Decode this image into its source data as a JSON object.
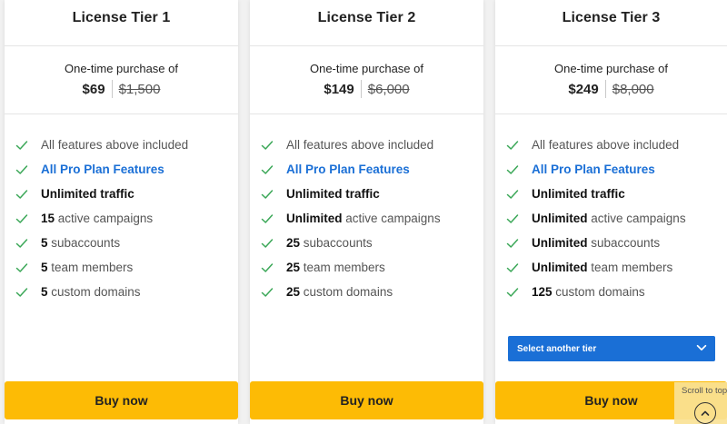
{
  "colors": {
    "accent": "#1a6fd6",
    "buy_button": "#fdbb05",
    "check": "#3aa757"
  },
  "tiers": [
    {
      "title": "License Tier 1",
      "price_caption": "One-time purchase of",
      "price_now": "$69",
      "price_old": "$1,500",
      "features": [
        {
          "strong": "",
          "text": "All features above included"
        },
        {
          "link": "All Pro Plan Features"
        },
        {
          "strong": "Unlimited traffic",
          "text": ""
        },
        {
          "strong": "15",
          "text": " active campaigns"
        },
        {
          "strong": "5",
          "text": " subaccounts"
        },
        {
          "strong": "5",
          "text": " team members"
        },
        {
          "strong": "5",
          "text": " custom domains"
        }
      ],
      "buy_label": "Buy now"
    },
    {
      "title": "License Tier 2",
      "price_caption": "One-time purchase of",
      "price_now": "$149",
      "price_old": "$6,000",
      "features": [
        {
          "strong": "",
          "text": "All features above included"
        },
        {
          "link": "All Pro Plan Features"
        },
        {
          "strong": "Unlimited traffic",
          "text": ""
        },
        {
          "strong": "Unlimited",
          "text": " active campaigns"
        },
        {
          "strong": "25",
          "text": " subaccounts"
        },
        {
          "strong": "25",
          "text": " team members"
        },
        {
          "strong": "25",
          "text": " custom domains"
        }
      ],
      "buy_label": "Buy now"
    },
    {
      "title": "License Tier 3",
      "price_caption": "One-time purchase of",
      "price_now": "$249",
      "price_old": "$8,000",
      "features": [
        {
          "strong": "",
          "text": "All features above included"
        },
        {
          "link": "All Pro Plan Features"
        },
        {
          "strong": "Unlimited traffic",
          "text": ""
        },
        {
          "strong": "Unlimited",
          "text": " active campaigns"
        },
        {
          "strong": "Unlimited",
          "text": " subaccounts"
        },
        {
          "strong": "Unlimited",
          "text": " team members"
        },
        {
          "strong": "125",
          "text": " custom domains"
        }
      ],
      "tier_select_label": "Select another tier",
      "buy_label": "Buy now"
    }
  ],
  "scroll_to_top": {
    "label": "Scroll to top",
    "icon": "chevron-up-icon"
  }
}
